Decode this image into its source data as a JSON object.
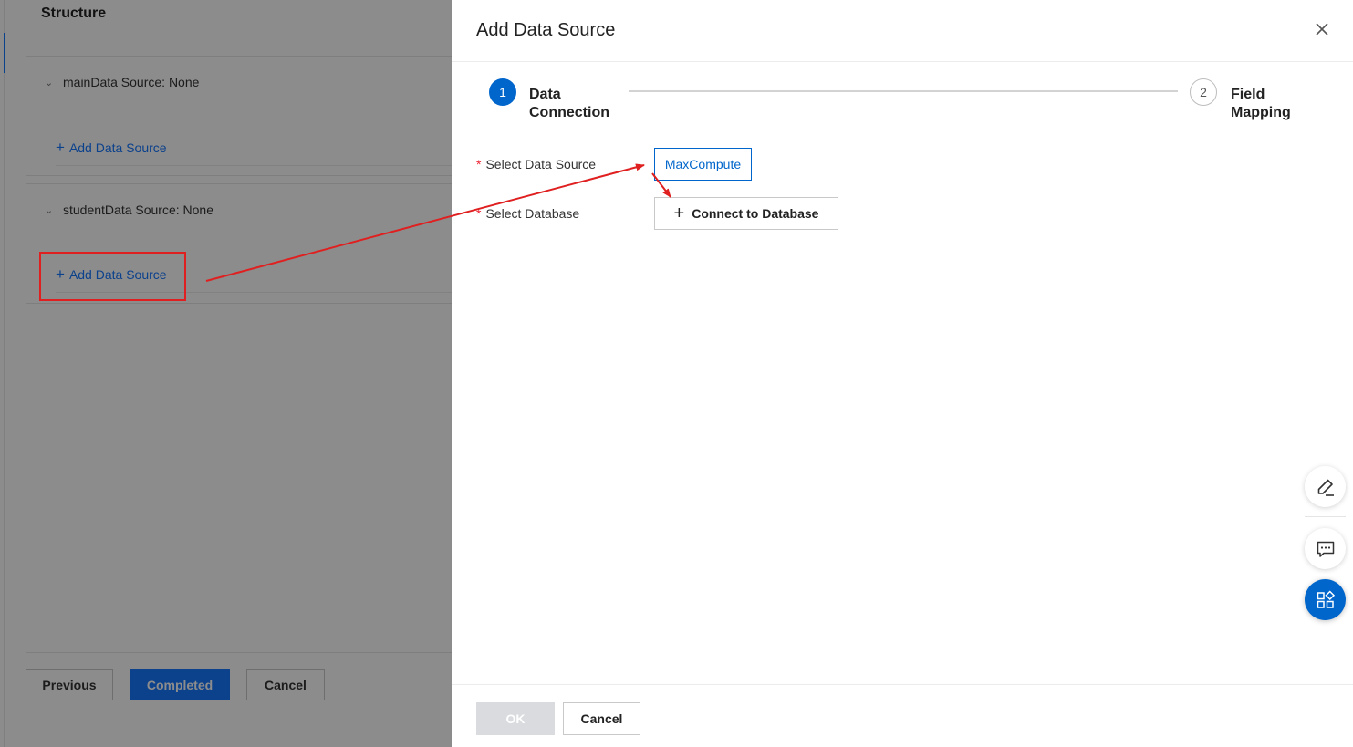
{
  "background": {
    "section_title": "Structure",
    "panels": [
      {
        "source_label": "mainData Source: None",
        "add_label": "Add Data Source"
      },
      {
        "source_label": "studentData Source: None",
        "add_label": "Add Data Source"
      }
    ],
    "buttons": {
      "previous": "Previous",
      "completed": "Completed",
      "cancel": "Cancel"
    }
  },
  "drawer": {
    "title": "Add Data Source",
    "steps": [
      {
        "number": "1",
        "label": "Data Connection",
        "state": "active"
      },
      {
        "number": "2",
        "label": "Field Mapping",
        "state": "pending"
      }
    ],
    "form": {
      "select_data_source_label": "Select Data Source",
      "select_database_label": "Select Database",
      "data_source_option": "MaxCompute",
      "connect_button": "Connect to Database"
    },
    "footer": {
      "ok": "OK",
      "cancel": "Cancel"
    }
  },
  "side_tools": [
    {
      "icon": "edit-icon"
    },
    {
      "icon": "feedback-icon"
    },
    {
      "icon": "apps-icon"
    }
  ],
  "colors": {
    "primary": "#0066cc",
    "link": "#1677ff",
    "annotation": "#e02020",
    "required": "#e23333"
  }
}
